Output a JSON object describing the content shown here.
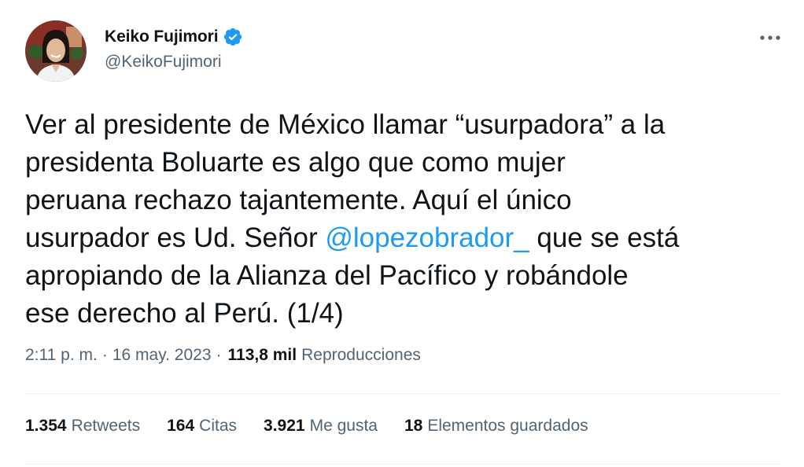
{
  "author": {
    "display_name": "Keiko Fujimori",
    "handle": "@KeikoFujimori",
    "verified": true,
    "avatar_icon": "profile-photo"
  },
  "tweet": {
    "text_lines": [
      "Ver al presidente de México llamar “usurpadora” a la",
      "presidenta Boluarte es algo que como mujer",
      "peruana rechazo tajantemente. Aquí el único",
      "usurpador es Ud. Señor ",
      "@lopezobrador_",
      " que se está",
      "apropiando de la Alianza del Pacífico y robándole",
      "ese derecho al Perú. (1/4)"
    ]
  },
  "meta": {
    "time": "2:11 p. m.",
    "date": "16 may. 2023",
    "separator": "·",
    "views_count": "113,8 mil",
    "views_label": "Reproducciones"
  },
  "stats": {
    "retweets_count": "1.354",
    "retweets_label": "Retweets",
    "quotes_count": "164",
    "quotes_label": "Citas",
    "likes_count": "3.921",
    "likes_label": "Me gusta",
    "bookmarks_count": "18",
    "bookmarks_label": "Elementos guardados"
  },
  "colors": {
    "accent": "#1d9bf0",
    "text": "#0f1419",
    "secondary": "#536471",
    "divider": "#eff3f4"
  }
}
